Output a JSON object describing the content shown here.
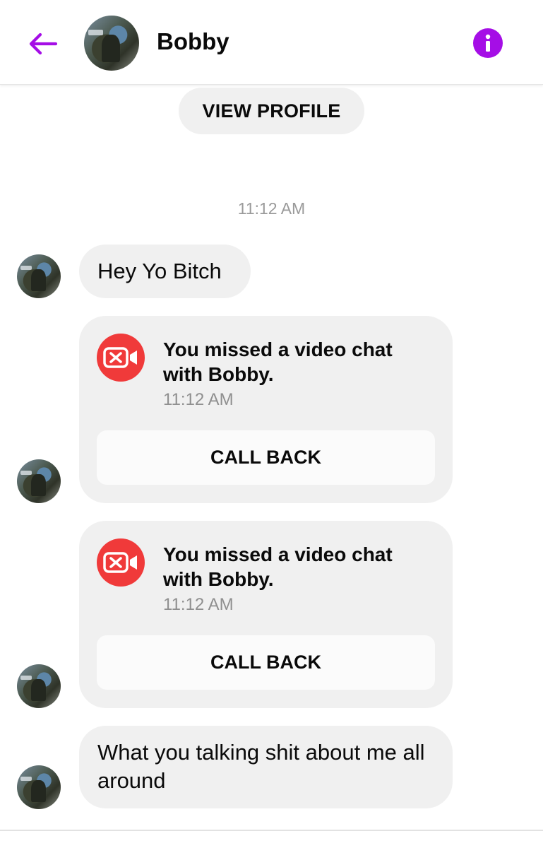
{
  "header": {
    "contact_name": "Bobby",
    "back_icon": "arrow-left-icon",
    "info_icon": "info-icon",
    "accent_color": "#a50ee6"
  },
  "view_profile_label": "VIEW PROFILE",
  "timestamp": "11:12 AM",
  "messages": [
    {
      "type": "text",
      "text": "Hey Yo Bitch"
    },
    {
      "type": "missed_call",
      "title": "You missed a video chat with Bobby.",
      "time": "11:12 AM",
      "action": "CALL BACK",
      "icon": "missed-video-call-icon",
      "icon_color": "#f03a3a"
    },
    {
      "type": "missed_call",
      "title": "You missed a video chat with Bobby.",
      "time": "11:12 AM",
      "action": "CALL BACK",
      "icon": "missed-video-call-icon",
      "icon_color": "#f03a3a"
    },
    {
      "type": "text",
      "text": "What you talking shit about me all around"
    }
  ]
}
